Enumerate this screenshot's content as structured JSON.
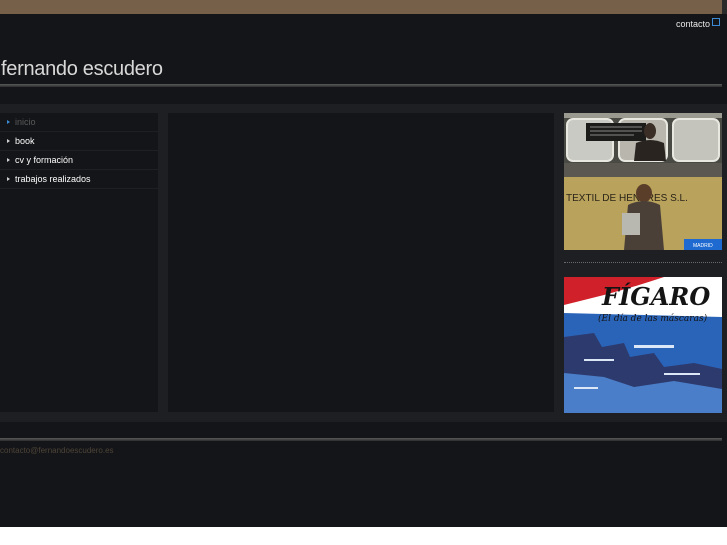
{
  "header": {
    "contact_label": "contacto",
    "site_title": "fernando escudero"
  },
  "nav": {
    "items": [
      {
        "label": "inicio",
        "active": true
      },
      {
        "label": "book",
        "active": false
      },
      {
        "label": "cv y formación",
        "active": false
      },
      {
        "label": "trabajos realizados",
        "active": false
      }
    ]
  },
  "sidebar": {
    "promo1": {
      "sign_text": "TEXTIL DE HENARES S.L.",
      "badge_text": "MADRID"
    },
    "promo2": {
      "title": "FÍGARO",
      "subtitle": "(El día de las máscaras)"
    }
  },
  "footer": {
    "email": "contacto@fernandoescudero.es"
  },
  "colors": {
    "accent": "#3a8ad6",
    "topbar": "#76604a",
    "background": "#141518"
  }
}
